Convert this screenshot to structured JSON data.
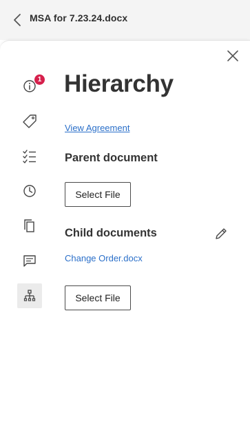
{
  "header": {
    "title": "MSA for 7.23.24.docx"
  },
  "sidebar": {
    "badge_count": "1",
    "items": [
      {
        "icon": "info-icon"
      },
      {
        "icon": "tag-icon"
      },
      {
        "icon": "checklist-icon"
      },
      {
        "icon": "clock-icon"
      },
      {
        "icon": "copy-icon"
      },
      {
        "icon": "comment-icon"
      },
      {
        "icon": "hierarchy-icon",
        "active": true
      }
    ]
  },
  "panel": {
    "heading": "Hierarchy",
    "view_agreement_link": "View Agreement",
    "parent_section": {
      "title": "Parent document",
      "select_button": "Select File"
    },
    "child_section": {
      "title": "Child documents",
      "files": [
        "Change Order.docx"
      ],
      "select_button": "Select File"
    }
  },
  "colors": {
    "accent_link": "#2a6fc9",
    "badge": "#d6204c",
    "header_bg": "#f4f4f4"
  }
}
